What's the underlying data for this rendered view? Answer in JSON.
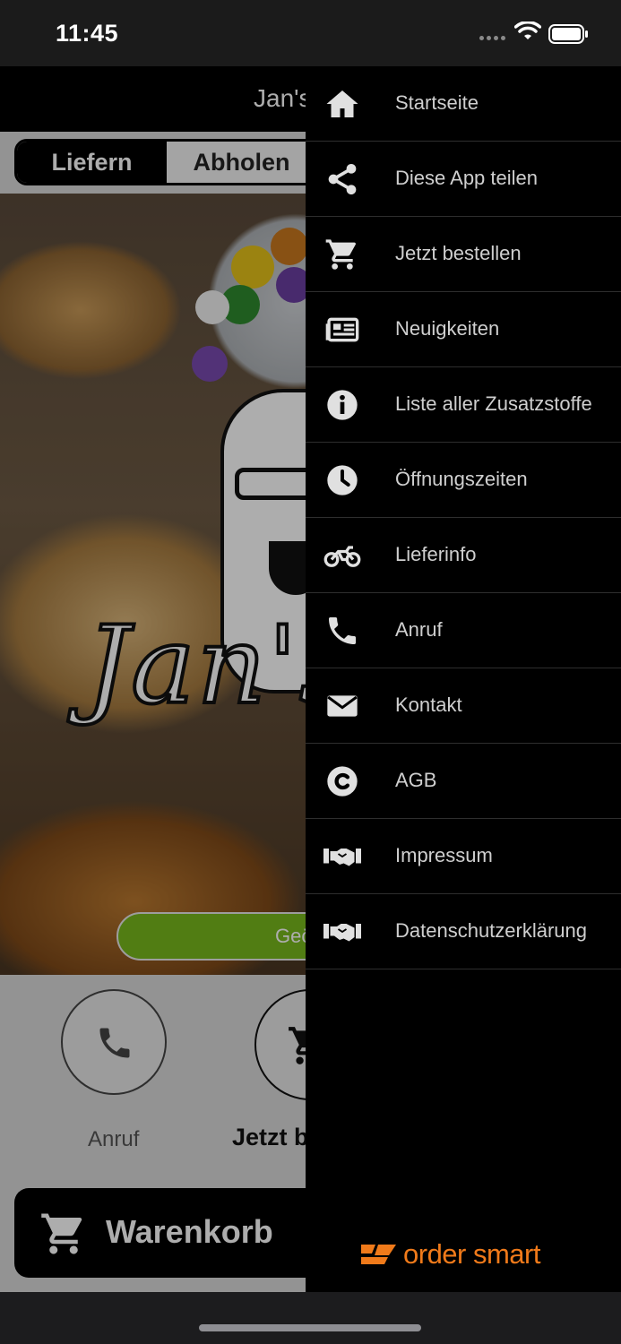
{
  "status_bar": {
    "time": "11:45",
    "icons": [
      "signal-dots-icon",
      "wifi-icon",
      "battery-icon"
    ]
  },
  "header": {
    "title": "Jan's"
  },
  "order_mode": {
    "options": [
      "Liefern",
      "Abholen"
    ],
    "selected": "Liefern"
  },
  "hero": {
    "logo_text": "Jan's",
    "status_button_label": "Geö"
  },
  "quick_actions": [
    {
      "label": "Anruf",
      "icon": "phone-icon"
    },
    {
      "label": "Jetzt b",
      "icon": "cart-icon"
    }
  ],
  "cart_bar": {
    "label": "Warenkorb",
    "icon": "cart-icon"
  },
  "drawer": {
    "items": [
      {
        "label": "Startseite",
        "icon": "home-icon"
      },
      {
        "label": "Diese App teilen",
        "icon": "share-icon"
      },
      {
        "label": "Jetzt bestellen",
        "icon": "cart-icon"
      },
      {
        "label": "Neuigkeiten",
        "icon": "newspaper-icon"
      },
      {
        "label": "Liste aller Zusatzstoffe",
        "icon": "info-icon"
      },
      {
        "label": "Öffnungszeiten",
        "icon": "clock-icon"
      },
      {
        "label": "Lieferinfo",
        "icon": "motorcycle-icon"
      },
      {
        "label": "Anruf",
        "icon": "phone-icon"
      },
      {
        "label": "Kontakt",
        "icon": "envelope-icon"
      },
      {
        "label": "AGB",
        "icon": "copyright-icon"
      },
      {
        "label": "Impressum",
        "icon": "handshake-icon"
      },
      {
        "label": "Datenschutzerklärung",
        "icon": "handshake-icon"
      }
    ],
    "brand": "order smart"
  },
  "colors": {
    "accent_green": "#78b81d",
    "brand_orange": "#f07a1a",
    "drawer_bg": "#000000"
  }
}
